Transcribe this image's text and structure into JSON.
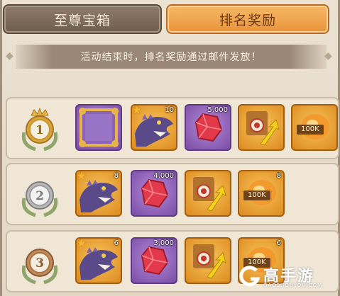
{
  "tabs": [
    {
      "label": "至尊宝箱",
      "active": false
    },
    {
      "label": "排名奖励",
      "active": true
    }
  ],
  "notice": "活动结束时，排名奖励通过邮件发放！",
  "ranks": [
    {
      "rank_label": "1",
      "rewards": [
        {
          "type": "frame",
          "icon": "avatar-frame-icon",
          "qty": ""
        },
        {
          "type": "dinosaur",
          "icon": "dinosaur-icon",
          "qty": "10",
          "star": true
        },
        {
          "type": "gem",
          "icon": "red-gem-icon",
          "qty": "5,000"
        },
        {
          "type": "boost",
          "icon": "upgrade-arrow-icon",
          "qty": ""
        },
        {
          "type": "food",
          "icon": "food-icon",
          "tag": "100K",
          "qty": ""
        }
      ]
    },
    {
      "rank_label": "2",
      "rewards": [
        {
          "type": "dinosaur",
          "icon": "dinosaur-icon",
          "qty": "8",
          "star": true
        },
        {
          "type": "gem",
          "icon": "red-gem-icon",
          "qty": "4,000"
        },
        {
          "type": "boost",
          "icon": "upgrade-arrow-icon",
          "qty": ""
        },
        {
          "type": "food",
          "icon": "food-icon",
          "tag": "100K",
          "qty": "8"
        }
      ]
    },
    {
      "rank_label": "3",
      "rewards": [
        {
          "type": "dinosaur",
          "icon": "dinosaur-icon",
          "qty": "6",
          "star": true
        },
        {
          "type": "gem",
          "icon": "red-gem-icon",
          "qty": "3,000"
        },
        {
          "type": "boost",
          "icon": "upgrade-arrow-icon",
          "qty": ""
        },
        {
          "type": "food",
          "icon": "food-icon",
          "tag": "100K",
          "qty": "6"
        }
      ]
    }
  ],
  "watermark": {
    "main": "高手游",
    "sub": "GAOSHOUYOU.COM"
  },
  "colors": {
    "active_tab": "#e9933a",
    "inactive_tab": "#7f6c5c",
    "gold": "#d9a53a",
    "silver": "#b8b8b8",
    "bronze": "#c08a5c"
  }
}
